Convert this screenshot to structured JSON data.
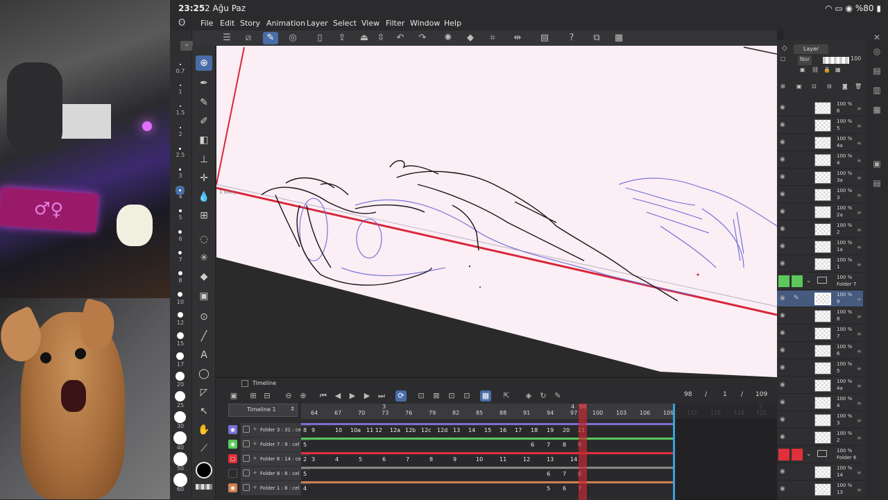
{
  "status_bar": {
    "time": "23:25",
    "date": "2 Ağu Paz",
    "battery": "%80"
  },
  "menu": [
    "File",
    "Edit",
    "Story",
    "Animation",
    "Layer",
    "Select",
    "View",
    "Filter",
    "Window",
    "Help"
  ],
  "brush_sizes": [
    "0.7",
    "1",
    "1.5",
    "2",
    "2.5",
    "3",
    "4",
    "5",
    "6",
    "7",
    "8",
    "10",
    "12",
    "15",
    "17",
    "20",
    "25",
    "30",
    "40",
    "50",
    "60"
  ],
  "canvas": {
    "story_label": "1 story"
  },
  "timeline": {
    "panel_title": "Timeline",
    "name": "Timeline 1",
    "current_frame": "98",
    "sep1": "/",
    "page": "1",
    "sep2": "/",
    "total_frames": "109",
    "ruler_top": [
      "3",
      "4",
      "98",
      "5"
    ],
    "ruler": [
      "64",
      "67",
      "70",
      "73",
      "76",
      "79",
      "82",
      "85",
      "88",
      "91",
      "94",
      "97",
      "100",
      "103",
      "106",
      "109",
      "112",
      "115",
      "118",
      "121"
    ],
    "tracks": [
      {
        "label": "Folder 3 : 31 : cel",
        "color": "#7b6fd6",
        "cells": [
          "8",
          "9",
          "10",
          "10a",
          "11 12",
          "12a",
          "12b",
          "12c",
          "12d",
          "13",
          "14",
          "15",
          "16",
          "17",
          "18",
          "19",
          "20",
          "21"
        ]
      },
      {
        "label": "Folder 7 : 9 : cel",
        "color": "#5bc85b",
        "cells": [
          "5",
          "6",
          "7",
          "8",
          "9"
        ]
      },
      {
        "label": "Folder 6 : 14 : cel",
        "color": "#e0303a",
        "cells": [
          "2",
          "3",
          "4",
          "5",
          "6",
          "7",
          "8",
          "9",
          "10",
          "11",
          "12",
          "13",
          "14"
        ]
      },
      {
        "label": "Folder 8 : 8 : cel",
        "color": "#888888",
        "cells": [
          "5",
          "6",
          "7",
          "8"
        ]
      },
      {
        "label": "Folder 1 : 8 : cel",
        "color": "#d08050",
        "cells": [
          "4",
          "5",
          "6",
          "7"
        ]
      }
    ]
  },
  "layer_panel": {
    "tab": "Layer",
    "blend_mode": "Nor",
    "opacity": "100",
    "layers": [
      {
        "pct": "100 %",
        "name": "6"
      },
      {
        "pct": "100 %",
        "name": "5"
      },
      {
        "pct": "100 %",
        "name": "4a"
      },
      {
        "pct": "100 %",
        "name": "4"
      },
      {
        "pct": "100 %",
        "name": "3a"
      },
      {
        "pct": "100 %",
        "name": "3"
      },
      {
        "pct": "100 %",
        "name": "2a"
      },
      {
        "pct": "100 %",
        "name": "2"
      },
      {
        "pct": "100 %",
        "name": "1a"
      },
      {
        "pct": "100 %",
        "name": "1"
      },
      {
        "pct": "100 %",
        "name": "Folder 7",
        "folder": true,
        "tag": "green"
      },
      {
        "pct": "100 %",
        "name": "9",
        "selected": true
      },
      {
        "pct": "100 %",
        "name": "8"
      },
      {
        "pct": "100 %",
        "name": "7"
      },
      {
        "pct": "100 %",
        "name": "6"
      },
      {
        "pct": "100 %",
        "name": "5"
      },
      {
        "pct": "100 %",
        "name": "4a"
      },
      {
        "pct": "100 %",
        "name": "4"
      },
      {
        "pct": "100 %",
        "name": "3"
      },
      {
        "pct": "100 %",
        "name": "2"
      },
      {
        "pct": "100 %",
        "name": "Folder 6",
        "folder": true,
        "tag": "red"
      },
      {
        "pct": "100 %",
        "name": "14"
      },
      {
        "pct": "100 %",
        "name": "13"
      }
    ]
  },
  "colors": {
    "accent": "#4a6da8",
    "canvas_paper": "#fbeef4",
    "frame_border": "#e0303a"
  }
}
